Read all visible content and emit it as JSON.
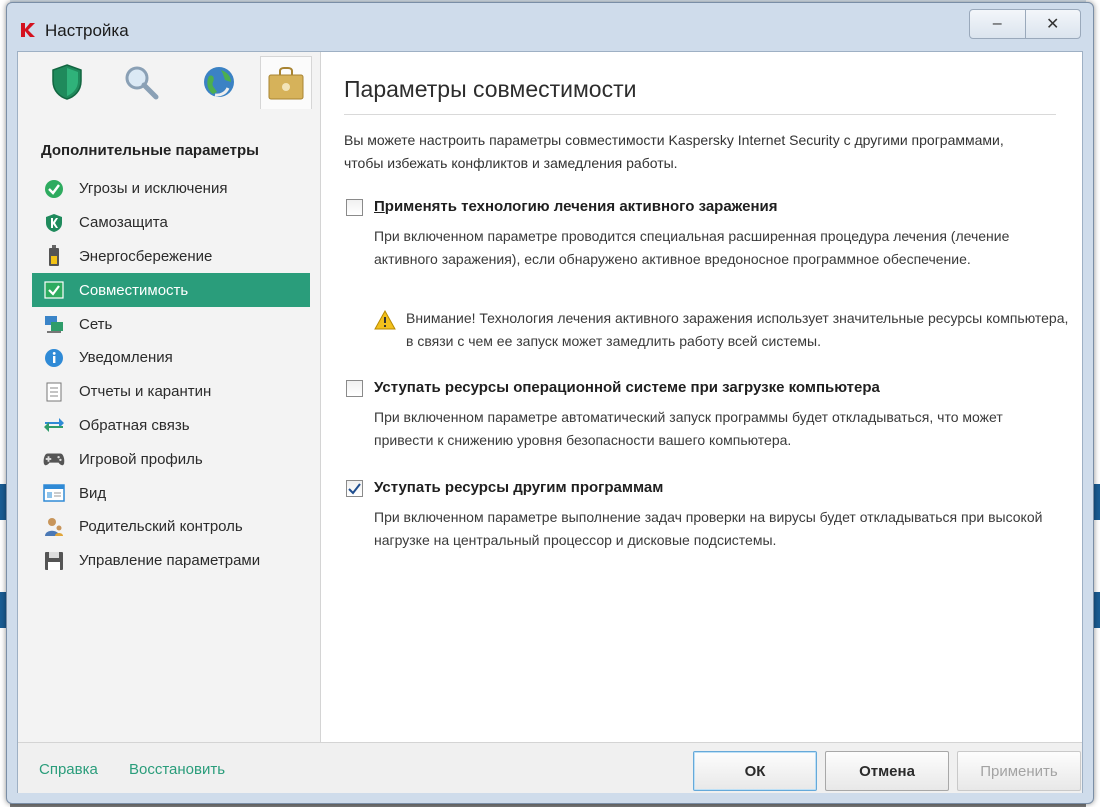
{
  "window": {
    "title": "Настройка",
    "controls": {
      "minimize": "–",
      "close": "✕"
    }
  },
  "sidebar": {
    "top_tabs": [
      {
        "icon": "shield-icon"
      },
      {
        "icon": "magnifier-icon"
      },
      {
        "icon": "globe-icon"
      },
      {
        "icon": "briefcase-icon",
        "selected": true
      }
    ],
    "header": "Дополнительные параметры",
    "items": [
      {
        "label": "Угрозы и исключения",
        "icon": "check-circle-icon"
      },
      {
        "label": "Самозащита",
        "icon": "kaspersky-shield-icon"
      },
      {
        "label": "Энергосбережение",
        "icon": "battery-icon"
      },
      {
        "label": "Совместимость",
        "icon": "compatibility-icon",
        "active": true
      },
      {
        "label": "Сеть",
        "icon": "network-icon"
      },
      {
        "label": "Уведомления",
        "icon": "info-icon"
      },
      {
        "label": "Отчеты и карантин",
        "icon": "report-icon"
      },
      {
        "label": "Обратная связь",
        "icon": "arrows-icon"
      },
      {
        "label": "Игровой профиль",
        "icon": "gamepad-icon"
      },
      {
        "label": "Вид",
        "icon": "window-view-icon"
      },
      {
        "label": "Родительский контроль",
        "icon": "parent-icon"
      },
      {
        "label": "Управление параметрами",
        "icon": "floppy-icon"
      }
    ]
  },
  "main": {
    "title": "Параметры совместимости",
    "intro": "Вы можете настроить параметры совместимости Kaspersky Internet Security с другими программами, чтобы избежать конфликтов и замедления работы.",
    "options": [
      {
        "title": "Применять технологию лечения активного заражения",
        "checked": false,
        "description": "При включенном параметре проводится специальная расширенная процедура лечения (лечение активного заражения), если обнаружено активное вредоносное программное обеспечение.",
        "warning": "Внимание! Технология лечения активного заражения использует значительные ресурсы компьютера, в связи с чем ее запуск может замедлить работу всей системы."
      },
      {
        "title": "Уступать ресурсы операционной системе при загрузке компьютера",
        "checked": false,
        "description": "При включенном параметре автоматический запуск программы будет откладываться, что может привести к снижению уровня безопасности вашего компьютера."
      },
      {
        "title": "Уступать ресурсы другим программам",
        "checked": true,
        "description": "При включенном параметре выполнение задач проверки на вирусы будет откладываться при высокой нагрузке на центральный процессор и дисковые подсистемы."
      }
    ]
  },
  "footer": {
    "help_link": "Справка",
    "restore_link": "Восстановить",
    "ok_label": "ОК",
    "cancel_label": "Отмена",
    "apply_label": "Применить",
    "apply_enabled": false
  },
  "colors": {
    "accent": "#2a9d7b",
    "title_red": "#d4111e"
  }
}
